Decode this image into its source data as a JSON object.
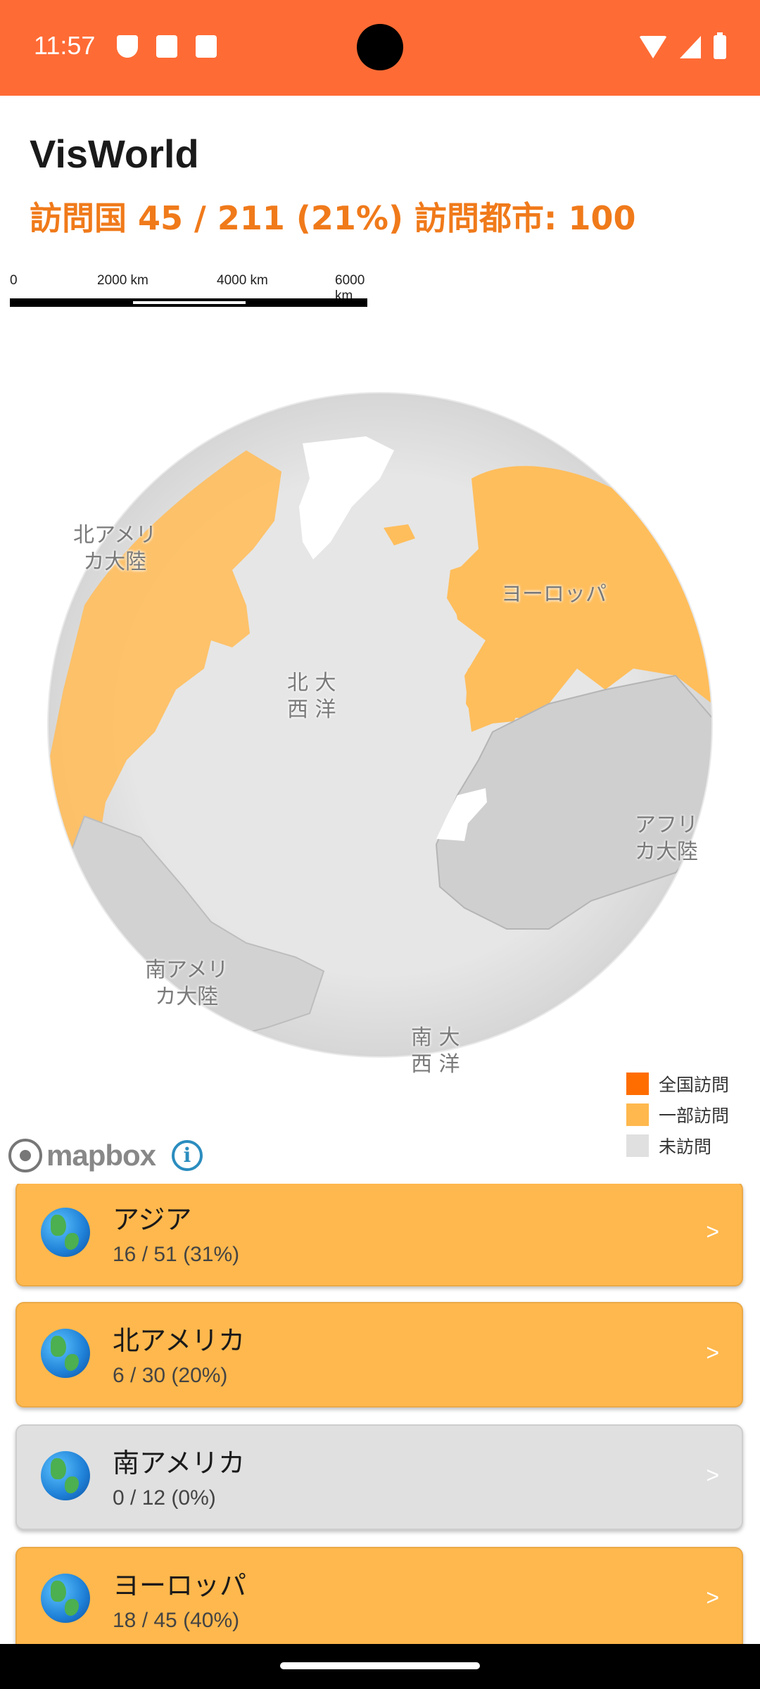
{
  "status_bar": {
    "time": "11:57"
  },
  "app": {
    "title": "VisWorld",
    "stats": "訪問国 45 / 211 (21%) 訪問都市: 100"
  },
  "scale": {
    "labels": [
      "0",
      "2000 km",
      "4000 km",
      "6000 km"
    ]
  },
  "map": {
    "labels": {
      "north_america": "北アメリ\nカ大陸",
      "europe": "ヨーロッパ",
      "north_atlantic": "北 大\n西 洋",
      "africa": "アフリ\nカ大陸",
      "south_america": "南アメリ\nカ大陸",
      "south_atlantic": "南 大\n西 洋"
    },
    "colors": {
      "full": "#ff6d00",
      "partial": "#ffbe5c",
      "none": "#dcdcdc",
      "ocean": "#e2e2e2"
    },
    "attribution": "mapbox"
  },
  "legend": [
    {
      "label": "全国訪問",
      "color": "#ff6d00"
    },
    {
      "label": "一部訪問",
      "color": "#ffb84d"
    },
    {
      "label": "未訪問",
      "color": "#e0e0e0"
    }
  ],
  "continents": [
    {
      "name": "アジア",
      "progress": "16 / 51 (31%)",
      "status": "partial",
      "icon": "globe-asia-icon"
    },
    {
      "name": "北アメリカ",
      "progress": "6 / 30 (20%)",
      "status": "partial",
      "icon": "globe-americas-icon"
    },
    {
      "name": "南アメリカ",
      "progress": "0 / 12 (0%)",
      "status": "none",
      "icon": "globe-americas-icon"
    },
    {
      "name": "ヨーロッパ",
      "progress": "18 / 45 (40%)",
      "status": "partial",
      "icon": "globe-europe-africa-icon"
    }
  ],
  "chevron": ">"
}
